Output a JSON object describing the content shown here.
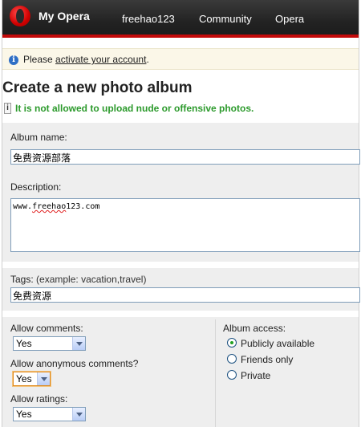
{
  "header": {
    "brand": "My Opera",
    "nav": [
      "freehao123",
      "Community",
      "Opera"
    ]
  },
  "notice": {
    "prefix": "Please",
    "link": "activate your account",
    "suffix": "."
  },
  "page": {
    "title": "Create a new photo album",
    "warning": "It is not allowed to upload nude or offensive photos."
  },
  "form": {
    "album_name": {
      "label": "Album name",
      "colon": ":",
      "value": "免费资源部落"
    },
    "description": {
      "label": "Description",
      "colon": ":",
      "value_before": "www.",
      "value_squiggle": "freehao",
      "value_after": "123.com"
    },
    "tags": {
      "label": "Tags",
      "colon": ":",
      "hint": "(example: vacation,travel)",
      "value": "免费资源"
    },
    "allow_comments": {
      "label": "Allow comments:",
      "value": "Yes"
    },
    "allow_anonymous": {
      "label": "Allow anonymous comments?",
      "value": "Yes"
    },
    "allow_ratings": {
      "label": "Allow ratings:",
      "value": "Yes"
    },
    "album_access": {
      "label": "Album access:",
      "options": [
        "Publicly available",
        "Friends only",
        "Private"
      ],
      "selected": "Publicly available"
    }
  },
  "colors": {
    "header": "#222222",
    "accent_red": "#c20a0a",
    "warning_green": "#2c9a2c",
    "input_border": "#7f9db9"
  },
  "icons": {
    "logo": "opera-logo-icon",
    "info": "info-icon",
    "warning": "warning-icon",
    "dropdown": "chevron-down-icon"
  }
}
